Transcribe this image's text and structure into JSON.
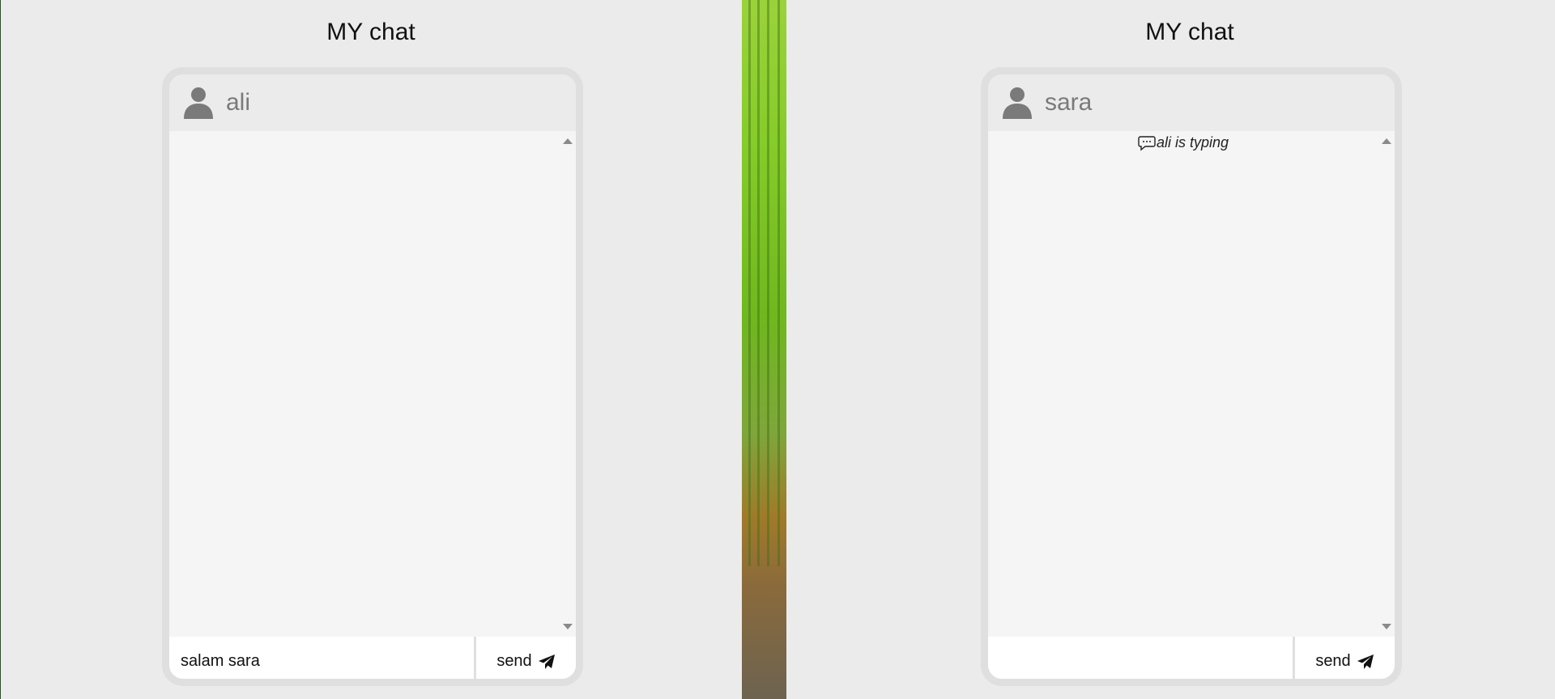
{
  "left_chat": {
    "title": "MY chat",
    "username": "ali",
    "input_value": "salam sara",
    "input_placeholder": "",
    "send_label": "send",
    "typing_text": ""
  },
  "right_chat": {
    "title": "MY chat",
    "username": "sara",
    "input_value": "",
    "input_placeholder": "",
    "send_label": "send",
    "typing_text": "ali is typing"
  },
  "icons": {
    "user": "user-icon",
    "send": "paper-plane-icon",
    "typing": "chat-bubble-dots-icon"
  },
  "colors": {
    "background": "#ebebeb",
    "frame": "#dfdfdf",
    "message_area": "#f5f5f5",
    "name_text": "#7a7a7a"
  }
}
